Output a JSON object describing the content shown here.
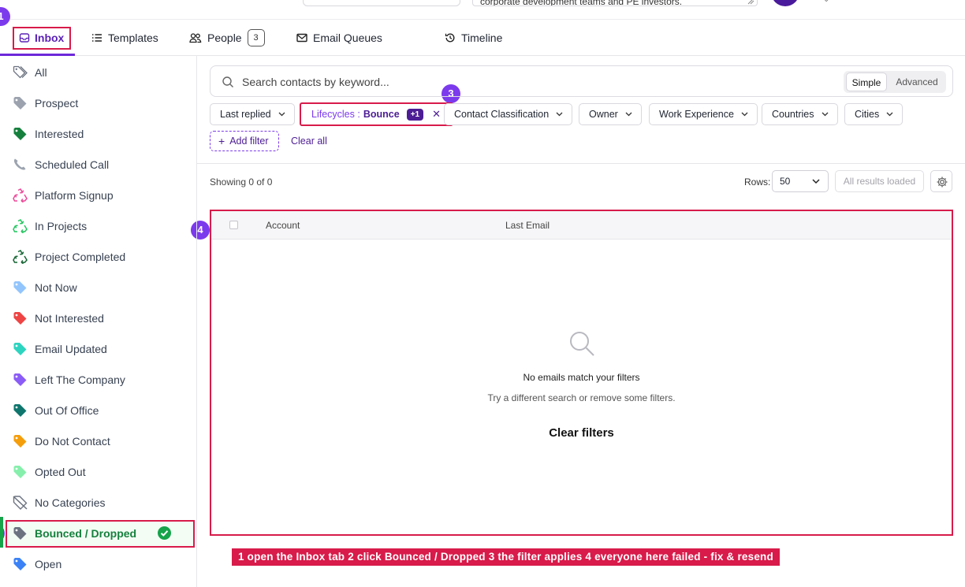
{
  "top": {
    "query_text": "corporate development teams and PE investors."
  },
  "tabs": [
    {
      "label": "Inbox",
      "icon": "inbox-icon"
    },
    {
      "label": "Templates",
      "icon": "list-icon"
    },
    {
      "label": "People",
      "icon": "people-icon",
      "count": "3"
    },
    {
      "label": "Email Queues",
      "icon": "mail-icon"
    },
    {
      "label": "Timeline",
      "icon": "history-icon"
    }
  ],
  "steps": [
    "1",
    "3",
    "4"
  ],
  "sidebar": {
    "items": [
      {
        "label": "All",
        "icon": "tags-icon",
        "color": "#6b7280"
      },
      {
        "label": "Prospect",
        "icon": "tag-icon",
        "color": "#9ca3af"
      },
      {
        "label": "Interested",
        "icon": "tag-icon",
        "color": "#15803d"
      },
      {
        "label": "Scheduled Call",
        "icon": "phone-icon",
        "color": "#9ca3af"
      },
      {
        "label": "Platform Signup",
        "icon": "recycle-icon",
        "color": "#ec4899"
      },
      {
        "label": "In Projects",
        "icon": "recycle-icon",
        "color": "#22c55e"
      },
      {
        "label": "Project Completed",
        "icon": "recycle-icon",
        "color": "#166534"
      },
      {
        "label": "Not Now",
        "icon": "tag-icon",
        "color": "#93c5fd"
      },
      {
        "label": "Not Interested",
        "icon": "tag-icon",
        "color": "#ef4444"
      },
      {
        "label": "Email Updated",
        "icon": "tag-icon",
        "color": "#2dd4bf"
      },
      {
        "label": "Left The Company",
        "icon": "tag-icon",
        "color": "#8b5cf6"
      },
      {
        "label": "Out Of Office",
        "icon": "tag-icon",
        "color": "#0f766e"
      },
      {
        "label": "Do Not Contact",
        "icon": "tag-icon",
        "color": "#f59e0b"
      },
      {
        "label": "Opted Out",
        "icon": "tag-icon",
        "color": "#86efac"
      },
      {
        "label": "No Categories",
        "icon": "tag-off-icon",
        "color": "#6b7280"
      },
      {
        "label": "Bounced / Dropped",
        "icon": "tag-icon",
        "color": "#6b7280",
        "active": true
      },
      {
        "label": "Open",
        "icon": "tag-icon",
        "color": "#3b82f6"
      }
    ]
  },
  "search": {
    "placeholder": "Search contacts by keyword...",
    "mode_simple": "Simple",
    "mode_advanced": "Advanced",
    "active_mode": "Simple"
  },
  "filters": {
    "last_replied": "Last replied",
    "lifecycle_label": "Lifecycles :",
    "lifecycle_value": "Bounce",
    "lifecycle_extra": "+1",
    "contact_classification": "Contact Classification",
    "owner": "Owner",
    "work_experience": "Work Experience",
    "countries": "Countries",
    "cities": "Cities",
    "add_filter": "Add filter",
    "clear_all": "Clear all"
  },
  "results": {
    "showing": "Showing 0 of 0",
    "rows_label": "Rows:",
    "rows_value": "50",
    "all_loaded": "All results loaded"
  },
  "table": {
    "columns": [
      "Account",
      "Last Email"
    ],
    "empty_title": "No emails match your filters",
    "empty_subtitle": "Try a different search or remove some filters.",
    "clear_filters": "Clear filters"
  },
  "caption": "1 open the Inbox tab   2 click Bounced / Dropped   3 the filter applies   4 everyone here failed - fix & resend",
  "colors": {
    "accent": "#6d28d9",
    "highlight": "#d81b4a",
    "success": "#16a34a"
  }
}
